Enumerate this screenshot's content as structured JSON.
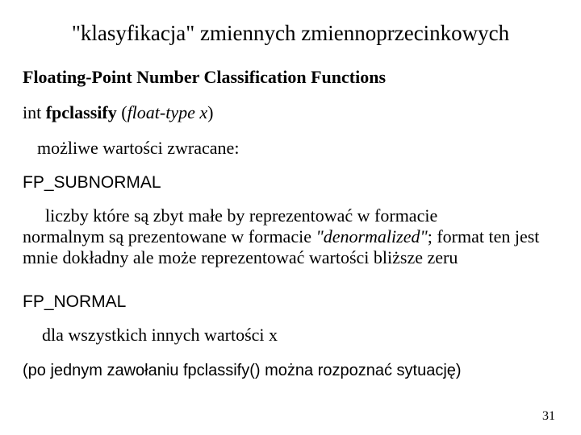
{
  "title": "\"klasyfikacja\" zmiennych zmiennoprzecinkowych",
  "subhead": "Floating-Point Number Classification Functions",
  "sig_pre": "int ",
  "sig_fn": "fpclassify",
  "sig_open": " (",
  "sig_arg": "float-type x",
  "sig_close": ")",
  "rvlabel": "możliwe wartości zwracane:",
  "const1": "FP_SUBNORMAL",
  "para1_a": "liczby które są zbyt małe by reprezentować w formacie",
  "para1_b": "normalnym są prezentowane w formacie ",
  "para1_it": "\"denormalized\"",
  "para1_c": "; format ten jest mnie dokładny ale może reprezentować wartości bliższe zeru",
  "const2": "FP_NORMAL",
  "para2": "dla wszystkich innych wartości x",
  "footer": "(po jednym zawołaniu fpclassify()  można rozpoznać sytuację)",
  "pagenum": "31"
}
